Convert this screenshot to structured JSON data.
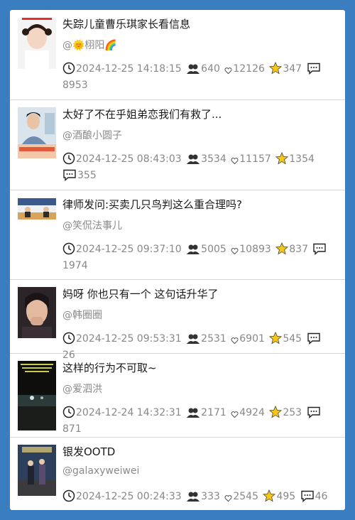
{
  "colors": {
    "background": "#3a7dc0",
    "star": "#f5c518"
  },
  "items": [
    {
      "title": "失踪儿童曹乐琪家长看信息",
      "author": "@🌞栩阳🌈",
      "time": "2024-12-25 14:18:15",
      "views": "640",
      "likes": "12126",
      "favs": "347",
      "comments": "8953"
    },
    {
      "title": "太好了不在乎姐弟恋我们有救了...",
      "author": "@酒酿小圆子",
      "time": "2024-12-25 08:43:03",
      "views": "3534",
      "likes": "11157",
      "favs": "1354",
      "comments": "355"
    },
    {
      "title": "律师发问:买卖几只鸟判这么重合理吗?",
      "author": "@笑侃法事儿",
      "time": "2024-12-25 09:37:10",
      "views": "5005",
      "likes": "10893",
      "favs": "837",
      "comments": "1974"
    },
    {
      "title": "妈呀 你也只有一个 这句话升华了",
      "author": "@韩圈圈",
      "time": "2024-12-25 09:53:31",
      "views": "2531",
      "likes": "6901",
      "favs": "545",
      "comments": "26"
    },
    {
      "title": "这样的行为不可取~",
      "author": "@爱泗洪",
      "time": "2024-12-24 14:32:31",
      "views": "2171",
      "likes": "4924",
      "favs": "253",
      "comments": "871"
    },
    {
      "title": "银发OOTD",
      "author": "@galaxyweiwei",
      "time": "2024-12-25 00:24:33",
      "views": "333",
      "likes": "2545",
      "favs": "495",
      "comments": "46"
    }
  ]
}
